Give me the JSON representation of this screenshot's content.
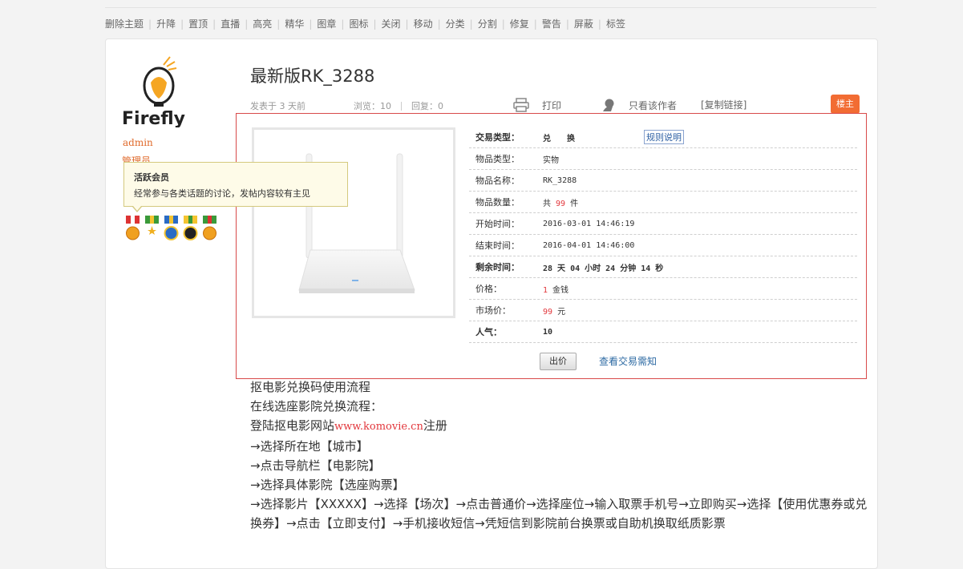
{
  "mod_actions": [
    "删除主题",
    "升降",
    "置顶",
    "直播",
    "高亮",
    "精华",
    "图章",
    "图标",
    "关闭",
    "移动",
    "分类",
    "分割",
    "修复",
    "警告",
    "屏蔽",
    "标签"
  ],
  "author": {
    "logo_text": "Firefly",
    "name": "admin",
    "group": "管理员",
    "tooltip_title": "活跃会员",
    "tooltip_desc": "经常参与各类话题的讨论，发帖内容较有主见"
  },
  "post": {
    "title": "最新版RK_3288",
    "posted_label": "发表于 3  天前",
    "views_label": "浏览：10",
    "replies_label": "回复：0",
    "print_label": "打印",
    "author_only_label": "只看该作者",
    "copy_link_label": "[复制链接]",
    "floor_badge": "楼主"
  },
  "trade": {
    "rows": [
      {
        "label": "交易类型：",
        "value": "兑　　换",
        "style": "red",
        "extra": "规则说明"
      },
      {
        "label": "物品类型：",
        "value": "实物"
      },
      {
        "label": "物品名称：",
        "value": "RK_3288"
      },
      {
        "label": "物品数量：",
        "value_parts": [
          "共 ",
          "99",
          " 件"
        ]
      },
      {
        "label": "开始时间：",
        "value": "2016-03-01 14:46:19"
      },
      {
        "label": "结束时间：",
        "value": "2016-04-01 14:46:00"
      },
      {
        "label": "剩余时间：",
        "value": "28 天 04 小时 24 分钟 14 秒",
        "style": "red"
      },
      {
        "label": "价格：",
        "value_parts": [
          "",
          "1",
          " 金钱"
        ]
      },
      {
        "label": "市场价：",
        "value_parts": [
          "",
          "99",
          " 元"
        ]
      },
      {
        "label": "人气：",
        "value": "10",
        "style": "red"
      }
    ],
    "bid_button": "出价",
    "notice_link": "查看交易需知"
  },
  "body": {
    "line1": "抠电影兑换码使用流程",
    "line2": "在线选座影院兑换流程：",
    "line3_prefix": "登陆抠电影网站",
    "line3_link": "www.komovie.cn",
    "line3_suffix": "注册",
    "line4": "→选择所在地【城市】",
    "line5": "→点击导航栏【电影院】",
    "line6": "→选择具体影院【选座购票】",
    "line7": "→选择影片【XXXXX】→选择【场次】→点击普通价→选择座位→输入取票手机号→立即购买→选择【使用优惠券或兑换券】→点击【立即支付】→手机接收短信→凭短信到影院前台换票或自助机换取纸质影票"
  },
  "colors": {
    "accent": "#e2373c",
    "orange": "#f26c33",
    "link": "#2d6aa3"
  }
}
